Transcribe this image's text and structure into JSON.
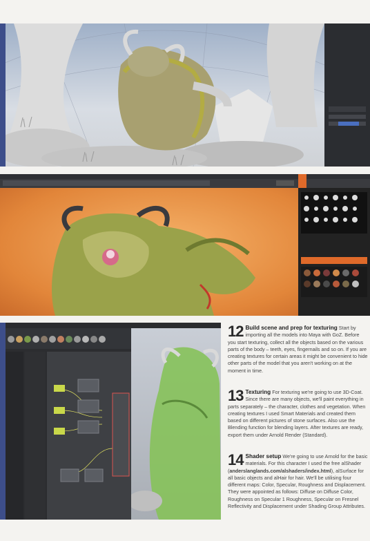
{
  "steps": [
    {
      "number": "12",
      "heading": "Build scene and prep for texturing",
      "body": "Start by importing all the models into Maya with GoZ. Before you start texturing, collect all the objects based on the various parts of the body – teeth, eyes, fingernails and so on. If you are creating textures for certain areas it might be convenient to hide other parts of the model that you aren't working on at the moment in time."
    },
    {
      "number": "13",
      "heading": "Texturing",
      "body": "For texturing we're going to use 3D-Coat. Since there are many objects, we'll paint everything in parts separately – the character, clothes and vegetation. When creating textures I used Smart Materials and created them based on different pictures of stone surfaces. Also use the Blending function for blending layers. After textures are ready, export them under Arnold Render (Standard)."
    },
    {
      "number": "14",
      "heading": "Shader setup",
      "body_pre": "We're going to use Arnold for the basic materials. For this character I used the free alShader (",
      "link": "anderslanglands.com/alshaders/index.html",
      "body_post": "), alSurface for all basic objects and alHair for hair. We'll be utilising four different maps: Color, Specular, Roughness and Displacement. They were appointed as follows: Diffuse on Diffuse Color, Roughness on Specular 1 Roughness, Specular on Fresnel Reflectivity and Displacement under Shading Group Attributes."
    }
  ],
  "colors": {
    "accent": "#e06a2a",
    "maya_blue": "#3d4e8a",
    "selected_mesh": "#8fb83a"
  }
}
